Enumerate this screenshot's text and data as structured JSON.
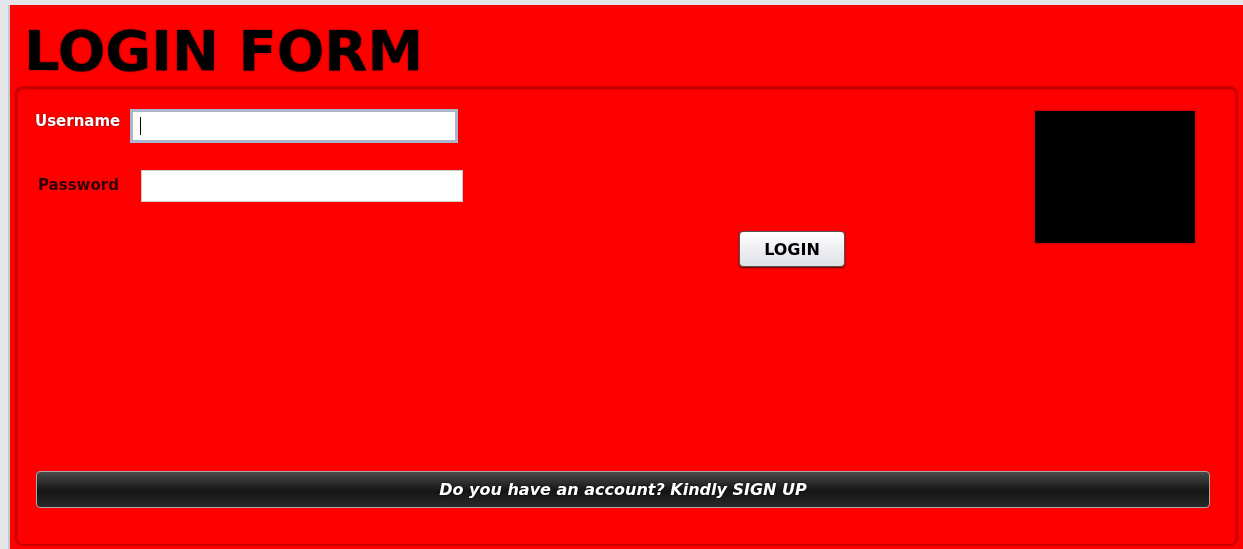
{
  "window": {
    "title": "LOGIN FORM"
  },
  "fields": [
    {
      "label": "Username",
      "focused": true
    },
    {
      "label": "Password",
      "focused": false
    }
  ],
  "login_button": "LOGIN",
  "image_box": {
    "kind": "blank"
  },
  "signup_bar": "Do you have an account? Kindly SIGN UP"
}
